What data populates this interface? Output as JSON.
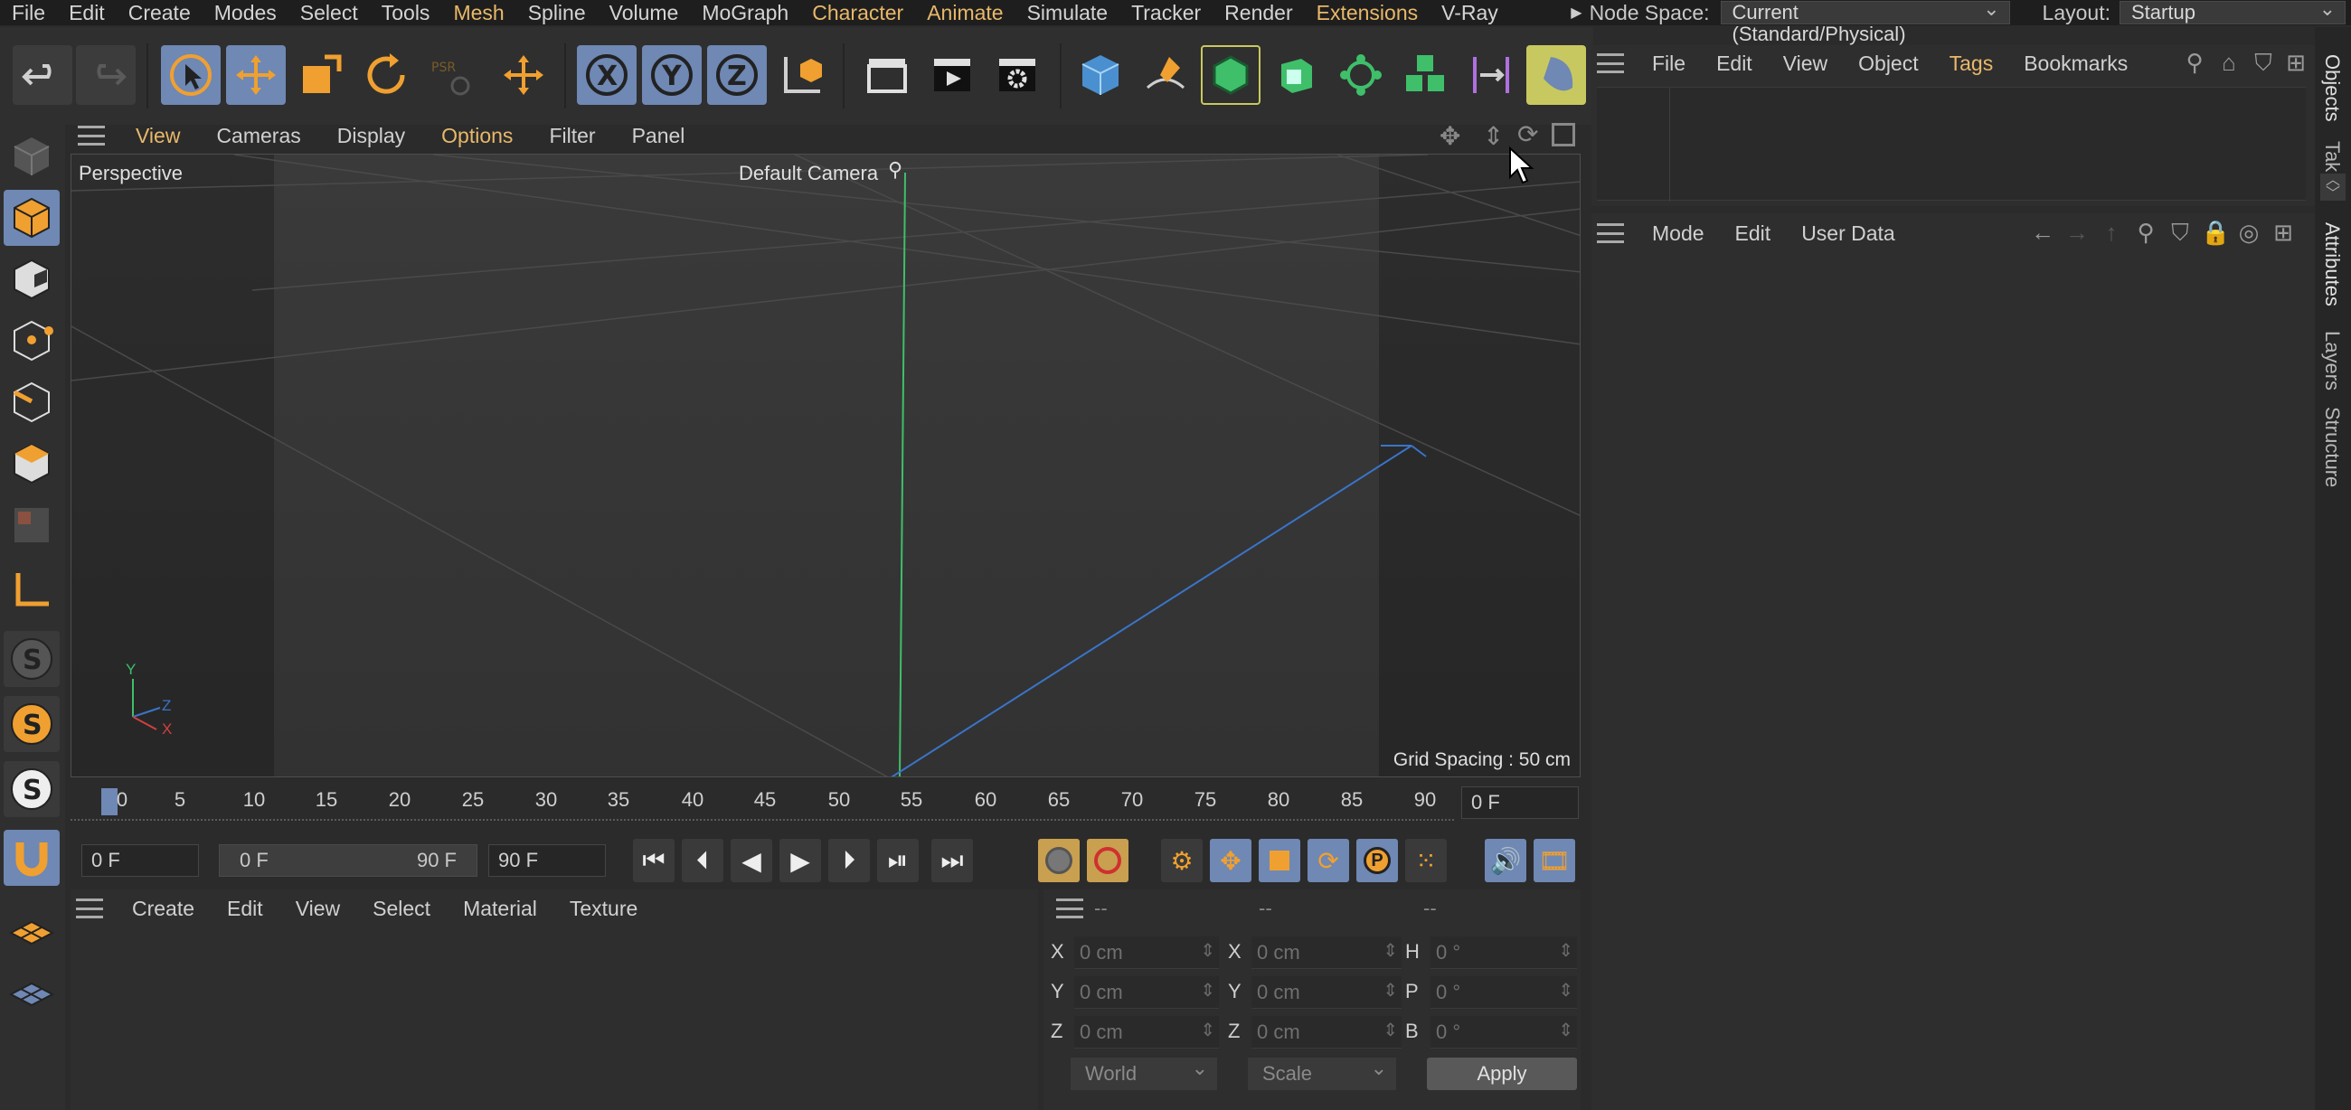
{
  "menubar": {
    "items": [
      "File",
      "Edit",
      "Create",
      "Modes",
      "Select",
      "Tools",
      "Mesh",
      "Spline",
      "Volume",
      "MoGraph",
      "Character",
      "Animate",
      "Simulate",
      "Tracker",
      "Render",
      "Extensions",
      "V-Ray"
    ],
    "highlighted": [
      "Mesh",
      "Character",
      "Animate",
      "Extensions"
    ],
    "node_space_label": "Node Space:",
    "node_space_value": "Current (Standard/Physical)",
    "layout_label": "Layout:",
    "layout_value": "Startup"
  },
  "viewport": {
    "menu": [
      "View",
      "Cameras",
      "Display",
      "Options",
      "Filter",
      "Panel"
    ],
    "highlighted": [
      "Options"
    ],
    "view_name": "Perspective",
    "camera_name": "Default Camera",
    "grid_spacing": "Grid Spacing : 50 cm",
    "axis_labels": {
      "y": "Y",
      "z": "Z",
      "x": "X"
    }
  },
  "timeline": {
    "ticks": [
      "0",
      "5",
      "10",
      "15",
      "20",
      "25",
      "30",
      "35",
      "40",
      "45",
      "50",
      "55",
      "60",
      "65",
      "70",
      "75",
      "80",
      "85",
      "90"
    ],
    "current_frame": "0 F"
  },
  "transport": {
    "start_frame": "0 F",
    "range_start": "0 F",
    "range_end": "90 F",
    "end_frame": "90 F"
  },
  "material_manager": {
    "menu": [
      "Create",
      "Edit",
      "View",
      "Select",
      "Material",
      "Texture"
    ]
  },
  "coordinates": {
    "headers": [
      "--",
      "--",
      "--"
    ],
    "rows": [
      {
        "l1": "X",
        "v1": "0 cm",
        "l2": "X",
        "v2": "0 cm",
        "l3": "H",
        "v3": "0 °"
      },
      {
        "l1": "Y",
        "v1": "0 cm",
        "l2": "Y",
        "v2": "0 cm",
        "l3": "P",
        "v3": "0 °"
      },
      {
        "l1": "Z",
        "v1": "0 cm",
        "l2": "Z",
        "v2": "0 cm",
        "l3": "B",
        "v3": "0 °"
      }
    ],
    "space": "World",
    "mode": "Scale",
    "apply": "Apply"
  },
  "object_manager": {
    "menu": [
      "File",
      "Edit",
      "View",
      "Object",
      "Tags",
      "Bookmarks"
    ],
    "highlighted": [
      "Tags"
    ]
  },
  "attribute_manager": {
    "menu": [
      "Mode",
      "Edit",
      "User Data"
    ]
  },
  "side_tabs": [
    "Objects",
    "Tak",
    "Attributes",
    "Layers",
    "Structure"
  ],
  "colors": {
    "accent_blue": "#6f88b4",
    "highlight_orange": "#e8b86a",
    "axis_green": "#3fbf6a",
    "axis_blue": "#3a74c8"
  }
}
